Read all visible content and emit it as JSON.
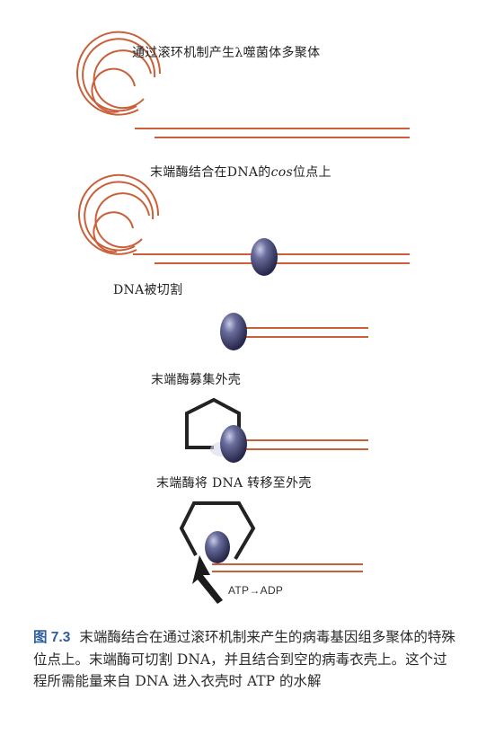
{
  "labels": {
    "step1": "通过滚环机制产生λ噬菌体多聚体",
    "step2_before": "末端酶结合在DNA的",
    "step2_italic": "cos",
    "step2_after": "位点上",
    "step3": "DNA被切割",
    "step4": "末端酶募集外壳",
    "step5": "末端酶将 DNA 转移至外壳",
    "atp": "ATP→ADP"
  },
  "caption": {
    "figure_number": "图 7.3",
    "text": "末端酶结合在通过滚环机制来产生的病毒基因组多聚体的特殊位点上。末端酶可切割 DNA，并且结合到空的病毒衣壳上。这个过程所需能量来自 DNA 进入衣壳时 ATP 的水解"
  },
  "colors": {
    "dna_strand": "#c9603a",
    "enzyme": "#3d3f66",
    "capsid": "#222222",
    "figure_number": "#2f5d9e"
  }
}
